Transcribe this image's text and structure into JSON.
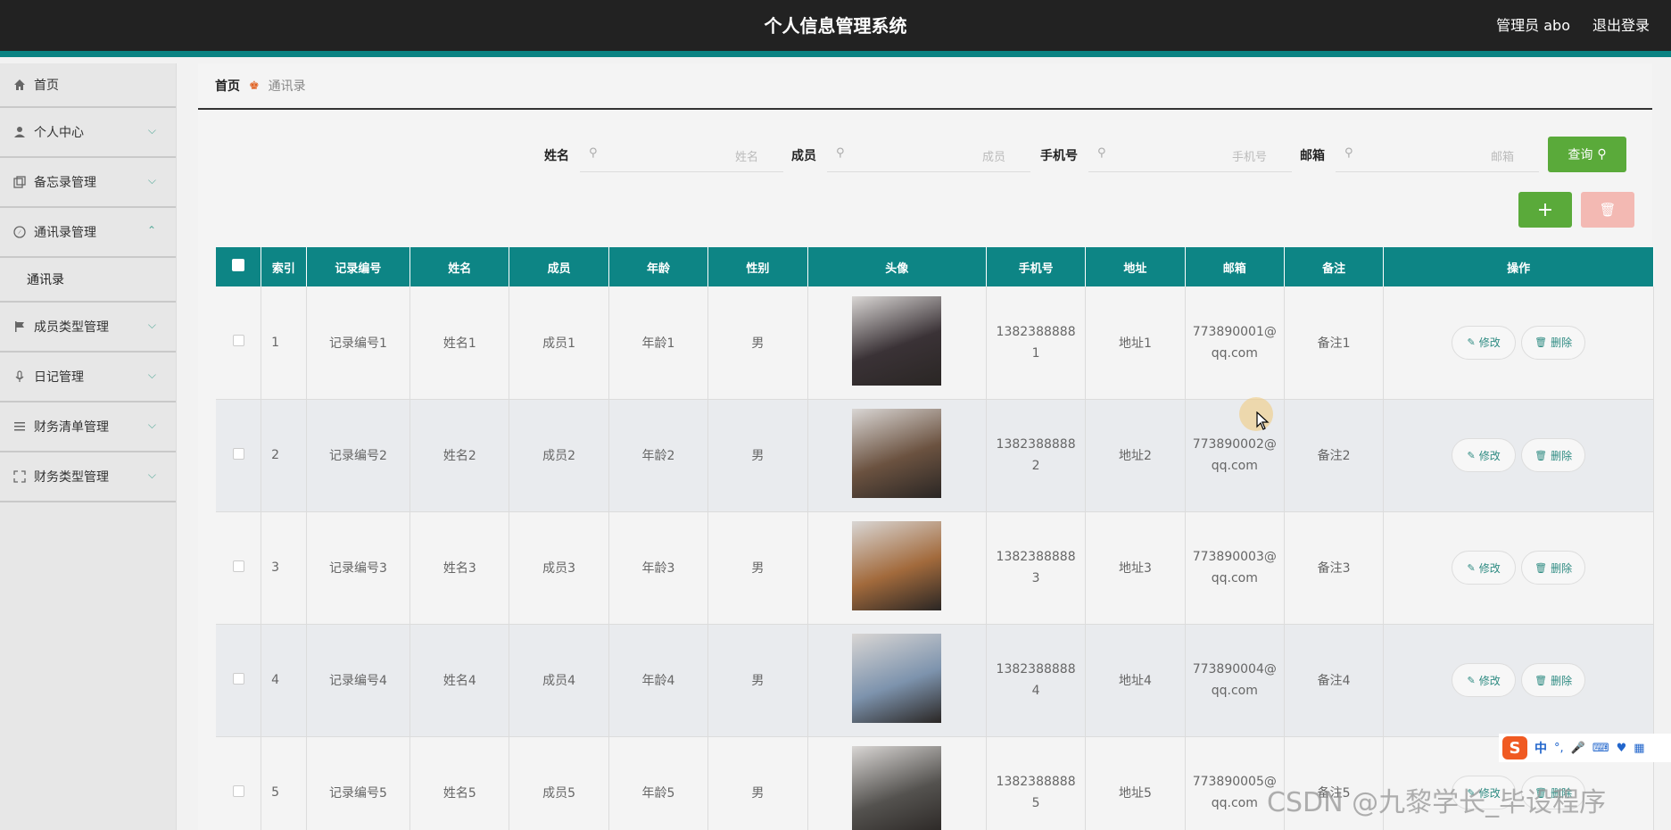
{
  "header": {
    "title": "个人信息管理系统",
    "admin": "管理员 abo",
    "logout": "退出登录"
  },
  "sidebar": {
    "items": [
      {
        "label": "首页",
        "icon": "home-icon"
      },
      {
        "label": "个人中心",
        "icon": "user-icon"
      },
      {
        "label": "备忘录管理",
        "icon": "copy-icon"
      },
      {
        "label": "通讯录管理",
        "icon": "compass-icon"
      },
      {
        "label": "成员类型管理",
        "icon": "flag-icon"
      },
      {
        "label": "日记管理",
        "icon": "microphone-icon"
      },
      {
        "label": "财务清单管理",
        "icon": "list-icon"
      },
      {
        "label": "财务类型管理",
        "icon": "fullscreen-icon"
      }
    ],
    "sub_items": [
      {
        "label": "通讯录"
      }
    ]
  },
  "breadcrumb": {
    "home": "首页",
    "current": "通讯录"
  },
  "search": {
    "fields": [
      {
        "label": "姓名",
        "placeholder": "姓名"
      },
      {
        "label": "成员",
        "placeholder": "成员"
      },
      {
        "label": "手机号",
        "placeholder": "手机号"
      },
      {
        "label": "邮箱",
        "placeholder": "邮箱"
      }
    ],
    "query_label": "查询"
  },
  "actions": {
    "add": "+",
    "delete": "🗑"
  },
  "table": {
    "headers": [
      "索引",
      "记录编号",
      "姓名",
      "成员",
      "年龄",
      "性别",
      "头像",
      "手机号",
      "地址",
      "邮箱",
      "备注",
      "操作"
    ],
    "rows": [
      {
        "index": "1",
        "record": "记录编号1",
        "name": "姓名1",
        "member": "成员1",
        "age": "年龄1",
        "gender": "男",
        "phone_a": "1382388888",
        "phone_b": "1",
        "address": "地址1",
        "email_a": "773890001@",
        "email_b": "qq.com",
        "note": "备注1",
        "avatar_color": "#3a3236"
      },
      {
        "index": "2",
        "record": "记录编号2",
        "name": "姓名2",
        "member": "成员2",
        "age": "年龄2",
        "gender": "男",
        "phone_a": "1382388888",
        "phone_b": "2",
        "address": "地址2",
        "email_a": "773890002@",
        "email_b": "qq.com",
        "note": "备注2",
        "avatar_color": "#6b5240"
      },
      {
        "index": "3",
        "record": "记录编号3",
        "name": "姓名3",
        "member": "成员3",
        "age": "年龄3",
        "gender": "男",
        "phone_a": "1382388888",
        "phone_b": "3",
        "address": "地址3",
        "email_a": "773890003@",
        "email_b": "qq.com",
        "note": "备注3",
        "avatar_color": "#a26a3c"
      },
      {
        "index": "4",
        "record": "记录编号4",
        "name": "姓名4",
        "member": "成员4",
        "age": "年龄4",
        "gender": "男",
        "phone_a": "1382388888",
        "phone_b": "4",
        "address": "地址4",
        "email_a": "773890004@",
        "email_b": "qq.com",
        "note": "备注4",
        "avatar_color": "#7d93ad"
      },
      {
        "index": "5",
        "record": "记录编号5",
        "name": "姓名5",
        "member": "成员5",
        "age": "年龄5",
        "gender": "男",
        "phone_a": "1382388888",
        "phone_b": "5",
        "address": "地址5",
        "email_a": "773890005@",
        "email_b": "qq.com",
        "note": "备注5",
        "avatar_color": "#54524f"
      }
    ],
    "edit_label": "修改",
    "delete_label": "删除"
  },
  "ime": {
    "logo": "S",
    "mode": "中"
  },
  "watermark": "CSDN @九黎学长_毕设程序"
}
